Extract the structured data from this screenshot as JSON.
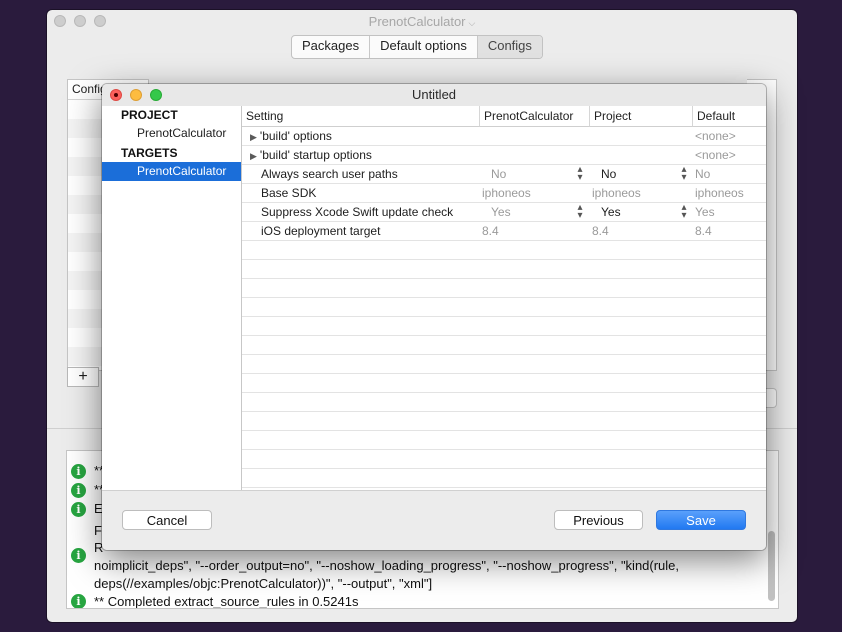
{
  "main_window": {
    "title": "PrenotCalculator",
    "segments": [
      "Packages",
      "Default options",
      "Configs"
    ],
    "selected_segment": "Configs",
    "config_list_header": "Config",
    "add_label": "+"
  },
  "console": {
    "lines": [
      {
        "icon": "info-icon",
        "text": "**"
      },
      {
        "icon": "info-icon",
        "text": "**"
      },
      {
        "icon": "info-icon",
        "text": "Ex"
      },
      {
        "icon": "",
        "text": "Fe"
      },
      {
        "icon": "",
        "text": "R"
      },
      {
        "icon": "info-icon",
        "text": "noimplicit_deps\", \"--order_output=no\", \"--noshow_loading_progress\", \"--noshow_progress\", \"kind(rule,"
      },
      {
        "icon": "",
        "text": "deps(//examples/objc:PrenotCalculator))\", \"--output\", \"xml\"]"
      },
      {
        "icon": "info-icon",
        "text": "** Completed extract_source_rules in 0.5241s"
      }
    ]
  },
  "dialog": {
    "title": "Untitled",
    "sidebar": {
      "project_header": "PROJECT",
      "project_item": "PrenotCalculator",
      "targets_header": "TARGETS",
      "target_item": "PrenotCalculator"
    },
    "table": {
      "columns": [
        "Setting",
        "PrenotCalculator",
        "Project",
        "Default"
      ],
      "rows": [
        {
          "setting": "'build' options",
          "expandable": true,
          "target": "",
          "project": "",
          "default": "<none>",
          "stepper": false
        },
        {
          "setting": "'build' startup options",
          "expandable": true,
          "target": "",
          "project": "",
          "default": "<none>",
          "stepper": false
        },
        {
          "setting": "Always search user paths",
          "expandable": false,
          "target": "No",
          "project": "No",
          "default": "No",
          "stepper": true
        },
        {
          "setting": "Base SDK",
          "expandable": false,
          "target": "iphoneos",
          "project": "iphoneos",
          "default": "iphoneos",
          "stepper": false
        },
        {
          "setting": "Suppress Xcode Swift update check",
          "expandable": false,
          "target": "Yes",
          "project": "Yes",
          "default": "Yes",
          "stepper": true
        },
        {
          "setting": "iOS deployment target",
          "expandable": false,
          "target": "8.4",
          "project": "8.4",
          "default": "8.4",
          "stepper": false
        }
      ]
    },
    "buttons": {
      "cancel": "Cancel",
      "previous": "Previous",
      "save": "Save"
    }
  }
}
